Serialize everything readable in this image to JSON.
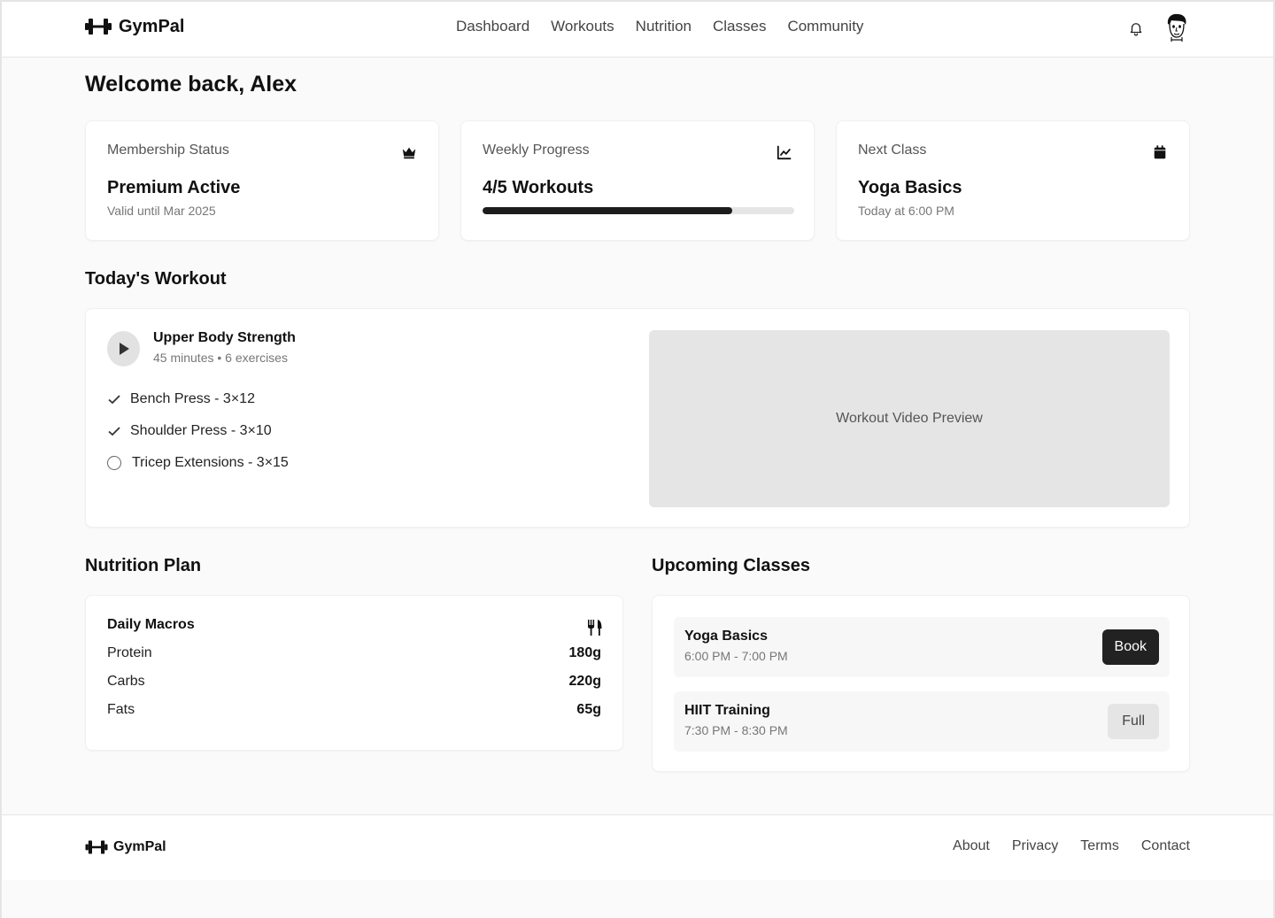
{
  "app": {
    "name": "GymPal"
  },
  "nav": {
    "items": [
      "Dashboard",
      "Workouts",
      "Nutrition",
      "Classes",
      "Community"
    ]
  },
  "header": {
    "notifications_icon": "bell-icon",
    "avatar_icon": "user-avatar"
  },
  "welcome": {
    "title": "Welcome back, Alex"
  },
  "stats": {
    "membership": {
      "label": "Membership Status",
      "value": "Premium Active",
      "sub": "Valid until Mar 2025",
      "icon": "crown-icon"
    },
    "progress": {
      "label": "Weekly Progress",
      "value": "4/5 Workouts",
      "completed": 4,
      "goal": 5,
      "percent": 80,
      "icon": "chart-line-icon"
    },
    "next_class": {
      "label": "Next Class",
      "value": "Yoga Basics",
      "sub": "Today at 6:00 PM",
      "icon": "calendar-icon"
    }
  },
  "workout": {
    "section_title": "Today's Workout",
    "title": "Upper Body Strength",
    "meta": "45 minutes • 6 exercises",
    "exercises": [
      {
        "label": "Bench Press - 3×12",
        "done": true
      },
      {
        "label": "Shoulder Press - 3×10",
        "done": true
      },
      {
        "label": "Tricep Extensions - 3×15",
        "done": false
      }
    ],
    "video_label": "Workout Video Preview"
  },
  "nutrition": {
    "section_title": "Nutrition Plan",
    "card_title": "Daily Macros",
    "icon": "utensils-icon",
    "macros": [
      {
        "name": "Protein",
        "value": "180g"
      },
      {
        "name": "Carbs",
        "value": "220g"
      },
      {
        "name": "Fats",
        "value": "65g"
      }
    ]
  },
  "classes": {
    "section_title": "Upcoming Classes",
    "items": [
      {
        "name": "Yoga Basics",
        "time": "6:00 PM - 7:00 PM",
        "action": "Book"
      },
      {
        "name": "HIIT Training",
        "time": "7:30 PM - 8:30 PM",
        "action": "Full"
      }
    ]
  },
  "footer": {
    "brand": "GymPal",
    "links": [
      "About",
      "Privacy",
      "Terms",
      "Contact"
    ]
  },
  "colors": {
    "accent": "#1c1c1c",
    "background": "#fafafa",
    "card": "#ffffff",
    "muted": "#e5e5e5"
  }
}
